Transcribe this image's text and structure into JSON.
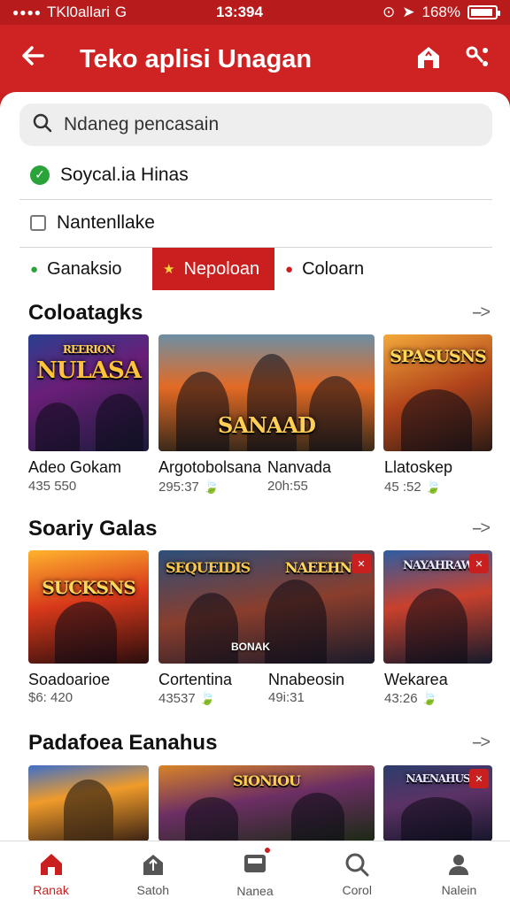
{
  "status": {
    "carrier": "TKl0allari",
    "carrier_suffix": "G",
    "time": "13:394",
    "battery": "168%"
  },
  "header": {
    "title": "Teko aplisi Unagan"
  },
  "search": {
    "placeholder": "Ndaneg pencasain"
  },
  "options": [
    {
      "label": "Soycal.ia Hinas",
      "checked": true
    },
    {
      "label": "Nantenllake",
      "checked": false
    }
  ],
  "chips": [
    {
      "label": "Ganaksio",
      "active": false
    },
    {
      "label": "Nepoloan",
      "active": true
    },
    {
      "label": "Coloarn",
      "active": false
    }
  ],
  "sections": [
    {
      "title": "Coloatagks",
      "more": "-->",
      "cards": [
        {
          "art": "NULASA",
          "art_top": "REERION",
          "name": "Adeo Gokam",
          "meta": "435 550",
          "leaf": ""
        },
        {
          "art": "SANAAD",
          "art_top": "",
          "name": "Argotobolsana",
          "name2": "Nanvada",
          "meta": "295:37",
          "meta2": "20h:55",
          "leaf": "🍃"
        },
        {
          "art": "SPASUSNS",
          "art_top": "",
          "name": "Llatoskep",
          "meta": "45 :52",
          "leaf": "🍃"
        }
      ]
    },
    {
      "title": "Soariy Galas",
      "more": "-->",
      "cards": [
        {
          "art": "SUCKSNS",
          "art_top": "",
          "name": "Soadoarioe",
          "meta": "$6: 420",
          "leaf": ""
        },
        {
          "art": "SEQUEIDIS",
          "art_top": "NAEEHN",
          "label": "BONAK",
          "name": "Cortentina",
          "name2": "Nnabeosin",
          "meta": "43537",
          "meta2": "49i:31",
          "leaf": "🍃"
        },
        {
          "art": "NAYAHRAW",
          "art_top": "",
          "name": "Wekarea",
          "meta": "43:26",
          "leaf": "🍃"
        }
      ]
    },
    {
      "title": "Padafoea Eanahus",
      "more": "-->",
      "cards": [
        {
          "art": ""
        },
        {
          "art": "SIONIOU"
        },
        {
          "art": "NAENAHUS"
        }
      ]
    }
  ],
  "nav": [
    {
      "label": "Ranak",
      "icon": "home-icon",
      "active": true
    },
    {
      "label": "Satoh",
      "icon": "store-icon",
      "active": false
    },
    {
      "label": "Nanea",
      "icon": "inbox-icon",
      "active": false
    },
    {
      "label": "Corol",
      "icon": "search-icon",
      "active": false
    },
    {
      "label": "Nalein",
      "icon": "profile-icon",
      "active": false
    }
  ],
  "colors": {
    "brand": "#c9201f",
    "check": "#2aa33a"
  }
}
